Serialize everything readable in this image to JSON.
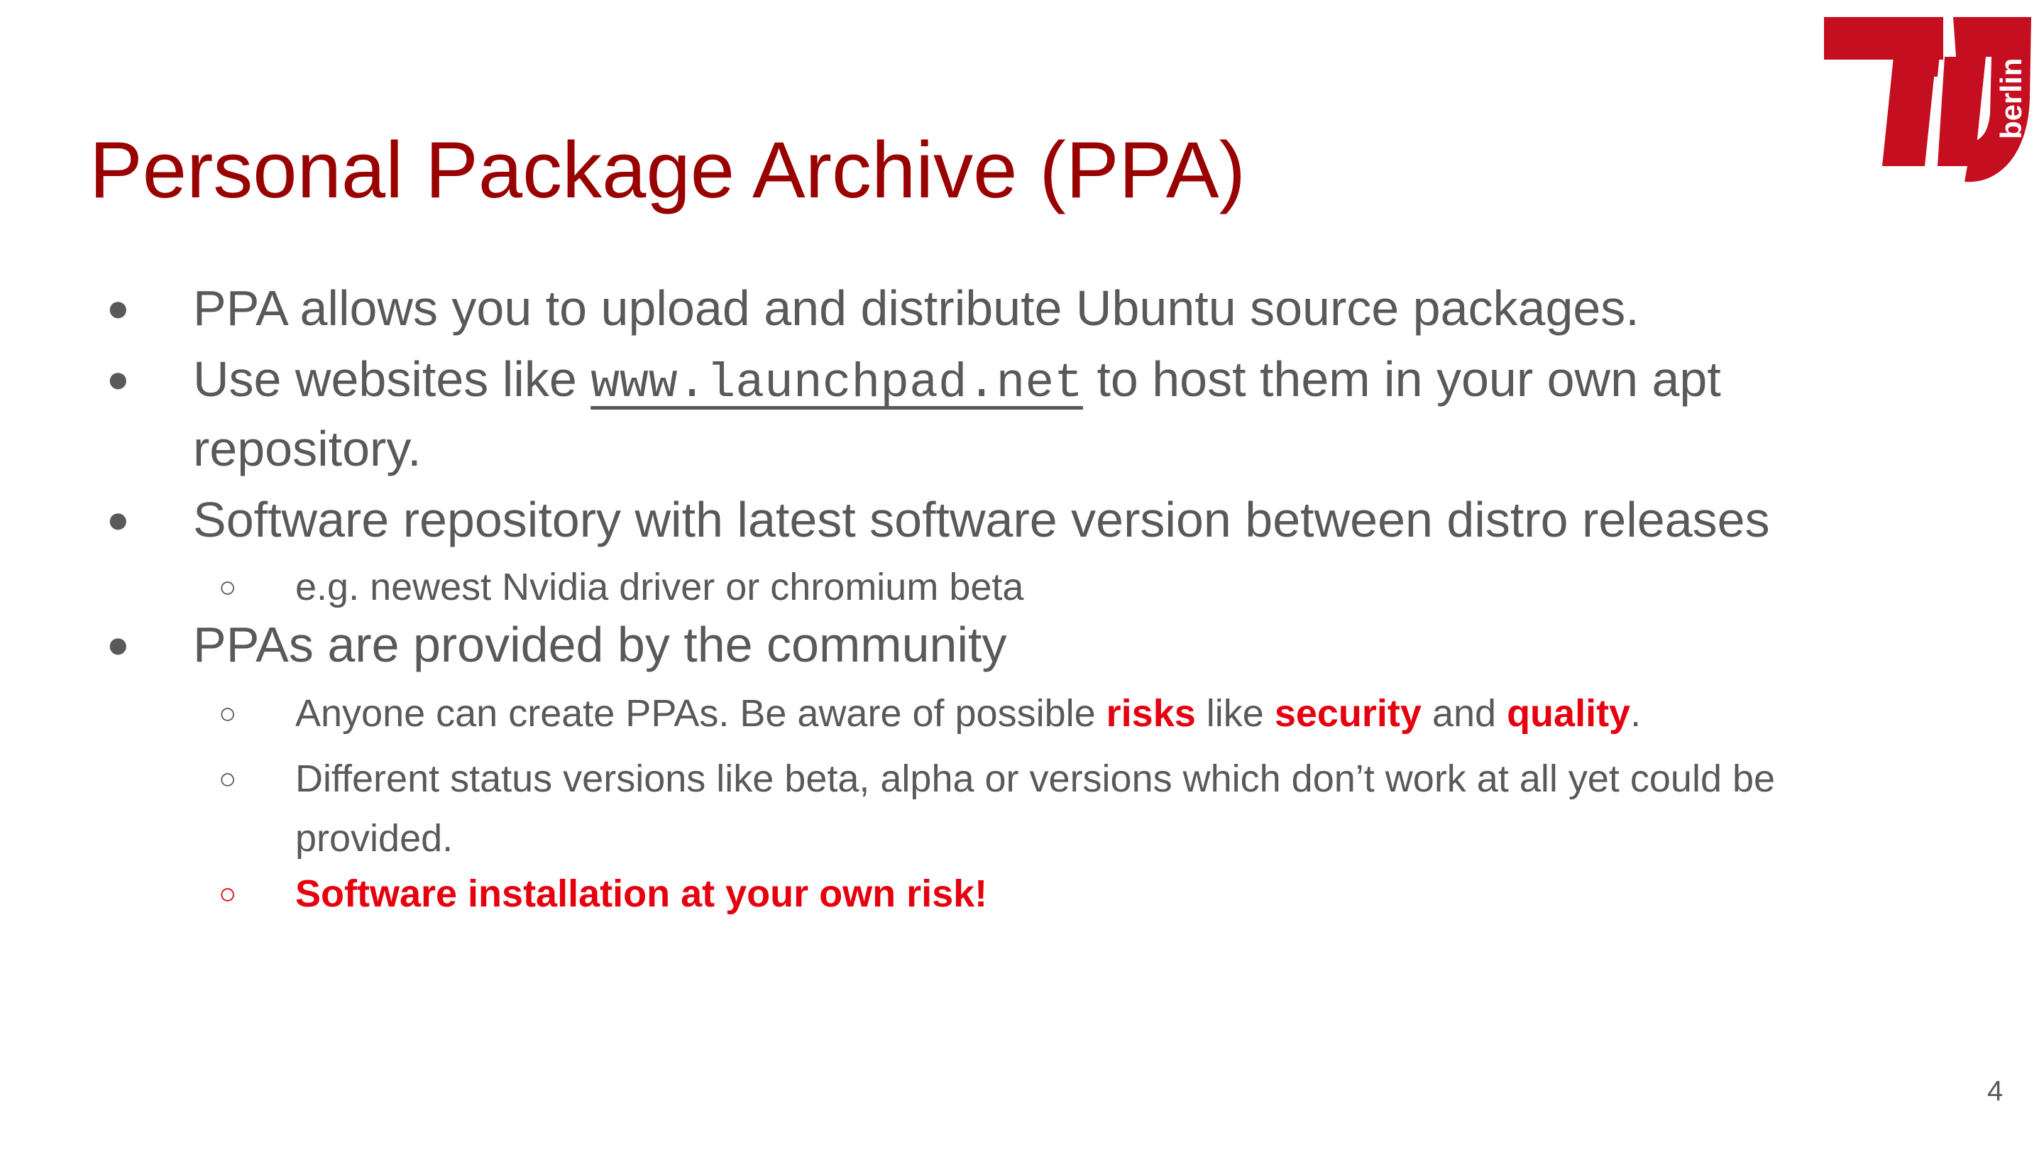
{
  "slide": {
    "title": "Personal Package Archive (PPA)",
    "logo_text": "berlin",
    "page_number": "4",
    "colors": {
      "title": "#990000",
      "body": "#595959",
      "accent": "#e6000e",
      "logo": "#c50e1f"
    }
  },
  "bullets": [
    {
      "marker": "●",
      "text": "PPA allows you to upload and distribute Ubuntu source packages."
    },
    {
      "marker": "●",
      "before": "Use websites like ",
      "link": "www.launchpad.net",
      "after": " to host them in your own apt",
      "continuation": "repository."
    },
    {
      "marker": "●",
      "text": "Software repository with latest software version between distro releases"
    },
    {
      "marker": "○",
      "text": "e.g. newest Nvidia driver or chromium beta"
    },
    {
      "marker": "●",
      "text": "PPAs are provided by the community"
    },
    {
      "marker": "○",
      "part1": "Anyone can create PPAs. Be aware of possible ",
      "risks": "risks",
      "part2": " like ",
      "security": "security",
      "part3": " and ",
      "quality": "quality",
      "part4": "."
    },
    {
      "marker": "○",
      "text": "Different status versions like beta, alpha or versions which don’t work at all yet could be",
      "continuation": "provided."
    },
    {
      "marker": "○",
      "text": "Software installation at your own risk!"
    }
  ]
}
